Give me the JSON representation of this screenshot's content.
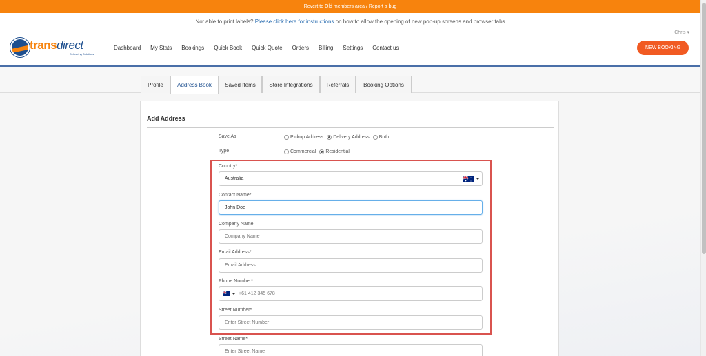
{
  "topbar": {
    "text": "Revert to Old members area / Report a bug"
  },
  "notice": {
    "before": "Not able to print labels? ",
    "link": "Please click here for instructions",
    "after": " on how to allow the opening of new pop-up screens and browser tabs"
  },
  "user": {
    "name": "Chris ▾"
  },
  "logo": {
    "part1": "trans",
    "part2": "direct",
    "tagline": "Delivering Solutions"
  },
  "nav": {
    "items": [
      "Dashboard",
      "My Stats",
      "Bookings",
      "Quick Book",
      "Quick Quote",
      "Orders",
      "Billing",
      "Settings",
      "Contact us"
    ]
  },
  "new_booking": {
    "label": "NEW BOOKING"
  },
  "tabs": [
    "Profile",
    "Address Book",
    "Saved Items",
    "Store Integrations",
    "Referrals",
    "Booking Options"
  ],
  "active_tab": "Address Book",
  "panel": {
    "title": "Add Address"
  },
  "save_as": {
    "label": "Save As",
    "options": [
      "Pickup Address",
      "Delivery Address",
      "Both"
    ],
    "selected": "Delivery Address"
  },
  "type": {
    "label": "Type",
    "options": [
      "Commercial",
      "Residential"
    ],
    "selected": "Residential"
  },
  "form": {
    "country_label": "Country*",
    "country_value": "Australia",
    "contact_label": "Contact Name*",
    "contact_value": "John Doe",
    "company_label": "Company Name",
    "company_placeholder": "Company Name",
    "email_label": "Email Address*",
    "email_placeholder": "Email Address",
    "phone_label": "Phone Number*",
    "phone_placeholder": "+61 412 345 678",
    "street_number_label": "Street Number*",
    "street_number_placeholder": "Enter Street Number",
    "street_name_label": "Street Name*",
    "street_name_placeholder": "Enter Street Name"
  },
  "colors": {
    "brand_orange": "#f7830d",
    "brand_blue": "#1d4f8f",
    "button": "#f15a22",
    "highlight": "#d9534f",
    "link": "#2a6db0"
  }
}
